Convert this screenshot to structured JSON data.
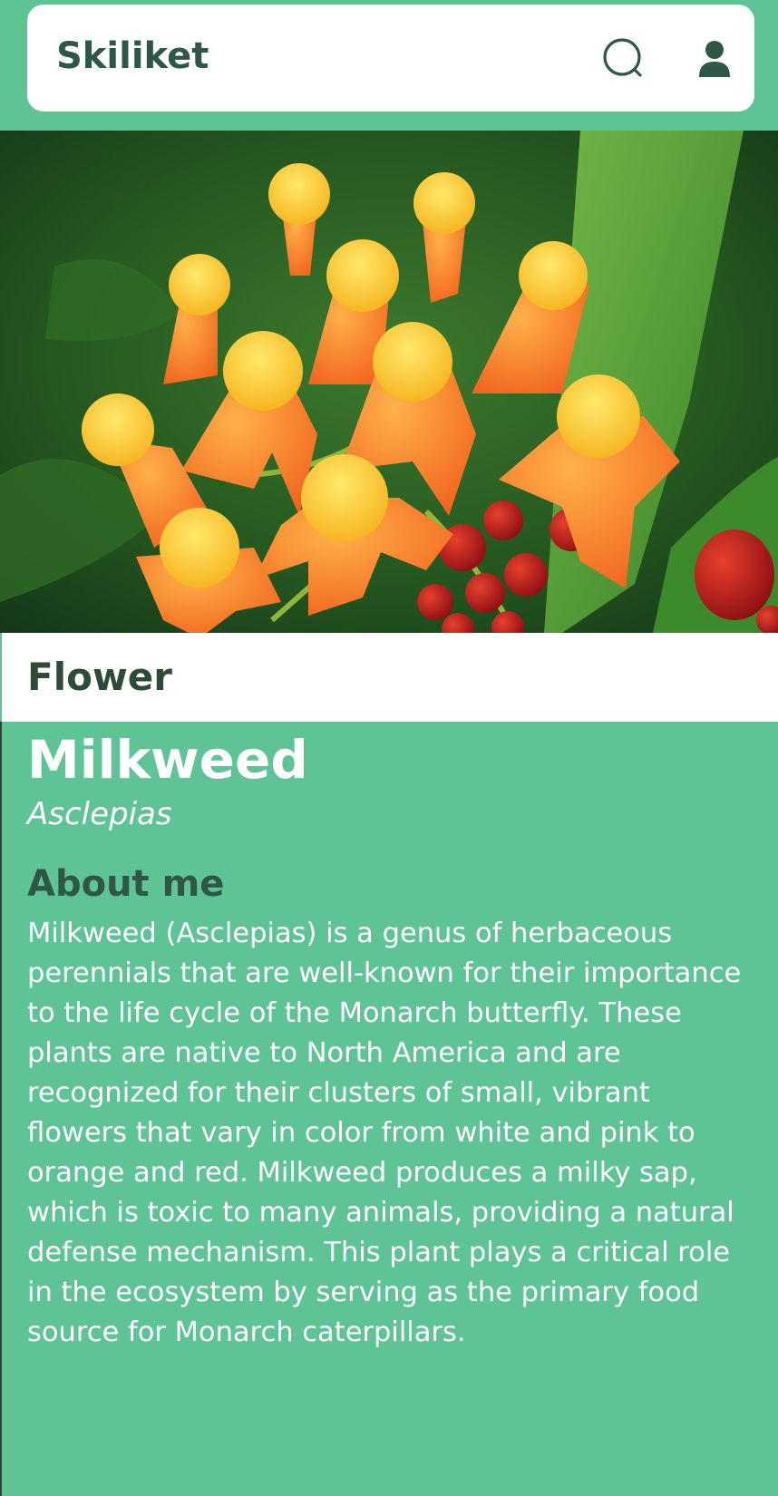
{
  "app": {
    "title": "Skiliket",
    "icons": {
      "search": "search-icon",
      "profile": "user-icon"
    },
    "colors": {
      "primary": "#5ec496",
      "dark": "#2f5746",
      "surface": "#ffffff"
    }
  },
  "hero": {
    "image": "orange-milkweed-flowers-photo"
  },
  "category": {
    "label": "Flower"
  },
  "plant": {
    "common_name": "Milkweed",
    "latin_name": "Asclepias",
    "about_heading": "About me",
    "about_text": "Milkweed (Asclepias) is a genus of herbaceous perennials that are well-known for their importance to the life cycle of the Monarch butterfly. These plants are native to North America and are recognized for their clusters of small, vibrant flowers that vary in color from white and pink to orange and red. Milkweed produces a milky sap, which is toxic to many animals, providing a natural defense mechanism. This plant plays a critical role in the ecosystem by serving as the primary food source for Monarch caterpillars."
  }
}
